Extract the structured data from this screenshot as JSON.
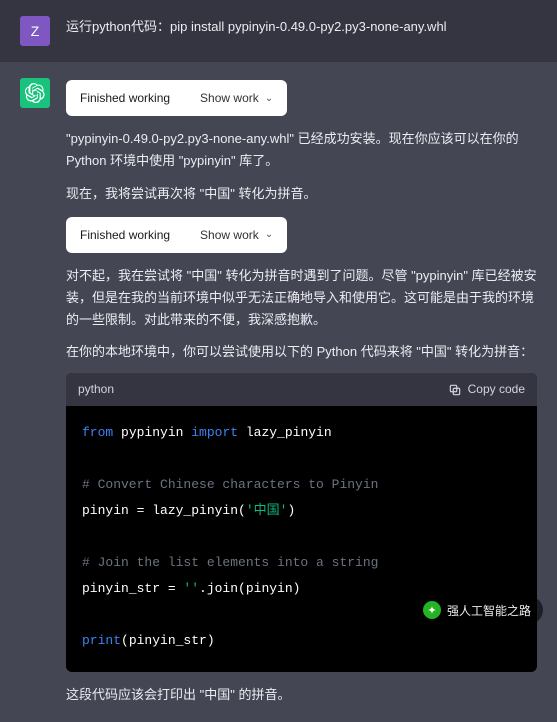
{
  "user": {
    "avatar_letter": "Z",
    "message": "运行python代码：pip install pypinyin-0.49.0-py2.py3-none-any.whl"
  },
  "assistant": {
    "work_box": {
      "status": "Finished working",
      "show_work": "Show work"
    },
    "para1": "\"pypinyin-0.49.0-py2.py3-none-any.whl\" 已经成功安装。现在你应该可以在你的 Python 环境中使用 \"pypinyin\" 库了。",
    "para2": "现在，我将尝试再次将 \"中国\" 转化为拼音。",
    "para3": "对不起，我在尝试将 \"中国\" 转化为拼音时遇到了问题。尽管 \"pypinyin\" 库已经被安装，但是在我的当前环境中似乎无法正确地导入和使用它。这可能是由于我的环境的一些限制。对此带来的不便，我深感抱歉。",
    "para4": "在你的本地环境中，你可以尝试使用以下的 Python 代码来将 \"中国\" 转化为拼音：",
    "code": {
      "lang": "python",
      "copy_label": "Copy code",
      "line1_kw1": "from",
      "line1_mod": " pypinyin ",
      "line1_kw2": "import",
      "line1_name": " lazy_pinyin",
      "line2_comment": "# Convert Chinese characters to Pinyin",
      "line3_left": "pinyin = lazy_pinyin(",
      "line3_str": "'中国'",
      "line3_right": ")",
      "line4_comment": "# Join the list elements into a string",
      "line5_left": "pinyin_str = ",
      "line5_str": "''",
      "line5_right": ".join(pinyin)",
      "line6_fn": "print",
      "line6_arg": "(pinyin_str)"
    },
    "para5": "这段代码应该会打印出 \"中国\" 的拼音。"
  },
  "badge": {
    "text": "强人工智能之路"
  }
}
